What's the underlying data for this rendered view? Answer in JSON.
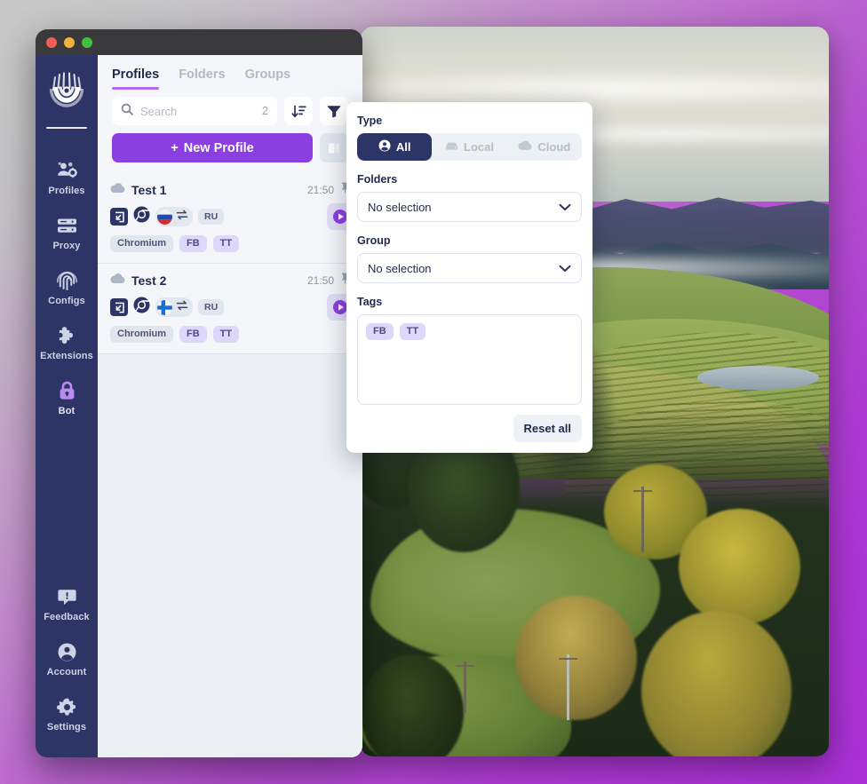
{
  "window": {
    "traffic_lights": [
      "close",
      "minimize",
      "maximize"
    ]
  },
  "sidebar": {
    "logo": "fingerprint-logo",
    "items": [
      {
        "icon": "profiles-icon",
        "label": "Profiles"
      },
      {
        "icon": "proxy-icon",
        "label": "Proxy"
      },
      {
        "icon": "configs-icon",
        "label": "Configs"
      },
      {
        "icon": "extensions-icon",
        "label": "Extensions"
      },
      {
        "icon": "lock-icon",
        "label": "Bot"
      }
    ],
    "bottom_items": [
      {
        "icon": "feedback-icon",
        "label": "Feedback"
      },
      {
        "icon": "account-icon",
        "label": "Account"
      },
      {
        "icon": "settings-icon",
        "label": "Settings"
      }
    ]
  },
  "tabs": [
    {
      "label": "Profiles",
      "active": true
    },
    {
      "label": "Folders",
      "active": false
    },
    {
      "label": "Groups",
      "active": false
    }
  ],
  "toolbar": {
    "search_placeholder": "Search",
    "search_value": "",
    "search_count": "2",
    "sort_icon": "sort-descending-icon",
    "filter_icon": "filter-funnel-icon",
    "new_profile_label": "New Profile",
    "new_profile_plus": "+",
    "view_toggle_icon": "column-layout-icon",
    "accent_color": "#8b3fe0"
  },
  "profiles": [
    {
      "storage_icon": "cloud-icon",
      "name": "Test 1",
      "time": "21:50",
      "pin_icon": "pin-icon",
      "launch_icon": "launch-arrow-icon",
      "browser_icon": "chromium-icon",
      "flag": "flag-ru",
      "proxy_icon": "proxy-swap-icon",
      "country_code": "RU",
      "tags": [
        "Chromium",
        "FB",
        "TT"
      ],
      "run_icon": "play-icon"
    },
    {
      "storage_icon": "cloud-icon",
      "name": "Test 2",
      "time": "21:50",
      "pin_icon": "pin-icon",
      "launch_icon": "launch-arrow-icon",
      "browser_icon": "chromium-icon",
      "flag": "flag-fi",
      "proxy_icon": "proxy-swap-icon",
      "country_code": "RU",
      "tags": [
        "Chromium",
        "FB",
        "TT"
      ],
      "run_icon": "play-icon"
    }
  ],
  "filter_popover": {
    "type": {
      "label": "Type",
      "options": [
        {
          "label": "All",
          "icon": "person-icon",
          "active": true
        },
        {
          "label": "Local",
          "icon": "server-icon",
          "active": false
        },
        {
          "label": "Cloud",
          "icon": "cloud-icon",
          "active": false
        }
      ]
    },
    "folders": {
      "label": "Folders",
      "value": "No selection",
      "chevron": "chevron-down-icon"
    },
    "group": {
      "label": "Group",
      "value": "No selection",
      "chevron": "chevron-down-icon"
    },
    "tags": {
      "label": "Tags",
      "items": [
        "FB",
        "TT"
      ]
    },
    "reset_label": "Reset all",
    "active_color": "#2d3566"
  }
}
